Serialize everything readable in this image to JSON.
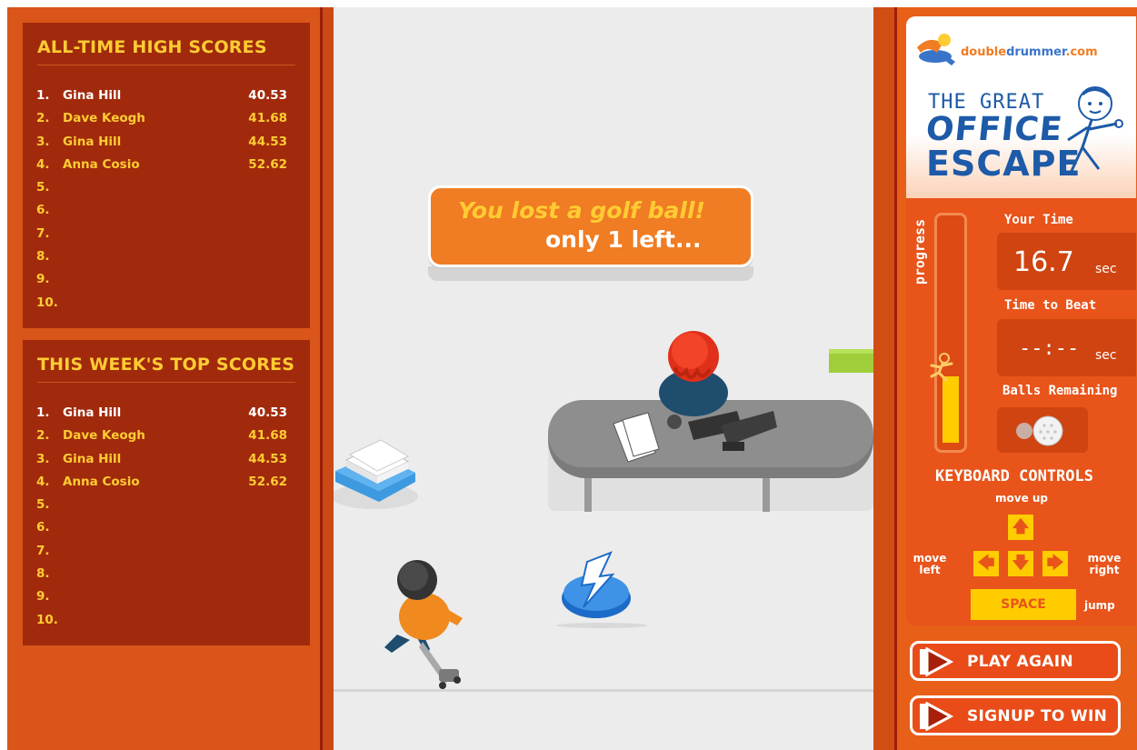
{
  "alltime": {
    "title": "ALL-TIME HIGH SCORES",
    "rows": [
      {
        "rank": "1.",
        "name": "Gina Hill",
        "time": "40.53"
      },
      {
        "rank": "2.",
        "name": "Dave Keogh",
        "time": "41.68"
      },
      {
        "rank": "3.",
        "name": "Gina Hill",
        "time": "44.53"
      },
      {
        "rank": "4.",
        "name": "Anna Cosio",
        "time": "52.62"
      },
      {
        "rank": "5.",
        "name": "",
        "time": ""
      },
      {
        "rank": "6.",
        "name": "",
        "time": ""
      },
      {
        "rank": "7.",
        "name": "",
        "time": ""
      },
      {
        "rank": "8.",
        "name": "",
        "time": ""
      },
      {
        "rank": "9.",
        "name": "",
        "time": ""
      },
      {
        "rank": "10.",
        "name": "",
        "time": ""
      }
    ]
  },
  "week": {
    "title": "THIS WEEK'S TOP SCORES",
    "rows": [
      {
        "rank": "1.",
        "name": "Gina Hill",
        "time": "40.53"
      },
      {
        "rank": "2.",
        "name": "Dave Keogh",
        "time": "41.68"
      },
      {
        "rank": "3.",
        "name": "Gina Hill",
        "time": "44.53"
      },
      {
        "rank": "4.",
        "name": "Anna Cosio",
        "time": "52.62"
      },
      {
        "rank": "5.",
        "name": "",
        "time": ""
      },
      {
        "rank": "6.",
        "name": "",
        "time": ""
      },
      {
        "rank": "7.",
        "name": "",
        "time": ""
      },
      {
        "rank": "8.",
        "name": "",
        "time": ""
      },
      {
        "rank": "9.",
        "name": "",
        "time": ""
      },
      {
        "rank": "10.",
        "name": "",
        "time": ""
      }
    ]
  },
  "message": {
    "line1": "You lost a golf ball!",
    "line2": "only 1 left..."
  },
  "logo": {
    "site_part1": "double",
    "site_part2": "drummer",
    "site_part3": ".com",
    "title_line1": "THE GREAT",
    "title_line2": "OFFICE",
    "title_line3": "ESCAPE"
  },
  "stats": {
    "progress_label": "progress",
    "progress_fraction": 0.3,
    "your_time_label": "Your Time",
    "your_time_value": "16.7",
    "your_time_unit": "sec",
    "beat_label": "Time to Beat",
    "beat_value": "--:--",
    "beat_unit": "sec",
    "balls_label": "Balls Remaining",
    "balls_remaining": 1
  },
  "keyboard": {
    "title": "KEYBOARD CONTROLS",
    "up_label": "move up",
    "left_label": "move left",
    "right_label": "move right",
    "jump_label": "jump",
    "key_up": "🡅",
    "key_left": "🡄",
    "key_down": "🡇",
    "key_right": "🡆",
    "key_space": "SPACE"
  },
  "buttons": {
    "play_again": "PLAY AGAIN",
    "signup": "SIGNUP TO WIN"
  },
  "colors": {
    "panel_orange": "#e85f18",
    "score_bg": "#a12a0c",
    "score_yellow": "#ffcc33",
    "brand_blue": "#1d5aa8",
    "progress_yellow": "#ffcc00"
  }
}
